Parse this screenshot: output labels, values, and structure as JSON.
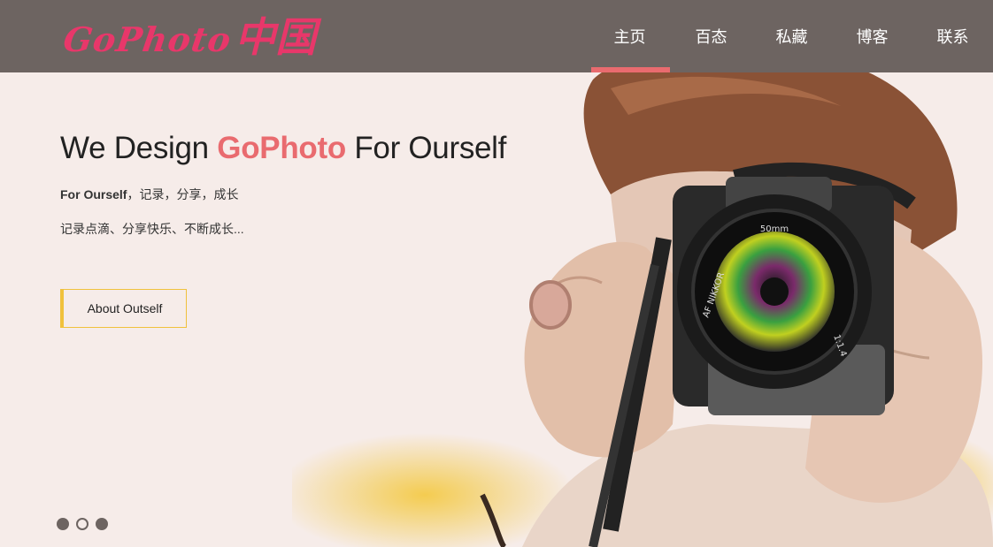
{
  "brand": {
    "logo_latin": "GoPhoto",
    "logo_cjk": "中国",
    "color": "#e8376a"
  },
  "nav": {
    "items": [
      {
        "label": "主页",
        "active": true
      },
      {
        "label": "百态",
        "active": false
      },
      {
        "label": "私藏",
        "active": false
      },
      {
        "label": "博客",
        "active": false
      },
      {
        "label": "联系",
        "active": false
      }
    ],
    "active_color": "#e96b6f",
    "bg_color": "#6d6461"
  },
  "hero": {
    "title_prefix": "We Design ",
    "title_accent": "GoPhoto",
    "title_suffix": " For Ourself",
    "sub_bold": "For Ourself",
    "sub_rest": "，记录，分享，成长",
    "desc": "记录点滴、分享快乐、不断成长...",
    "button_label": "About Outself",
    "accent_color": "#e96b6f",
    "button_color": "#f0c13c",
    "photo_icon": "photographer-with-camera-image",
    "lens_text": "50mm",
    "lens_brand": "AF NIKKOR",
    "lens_aperture": "1:1.4"
  },
  "slider": {
    "dots": [
      "filled",
      "hollow",
      "filled"
    ]
  }
}
